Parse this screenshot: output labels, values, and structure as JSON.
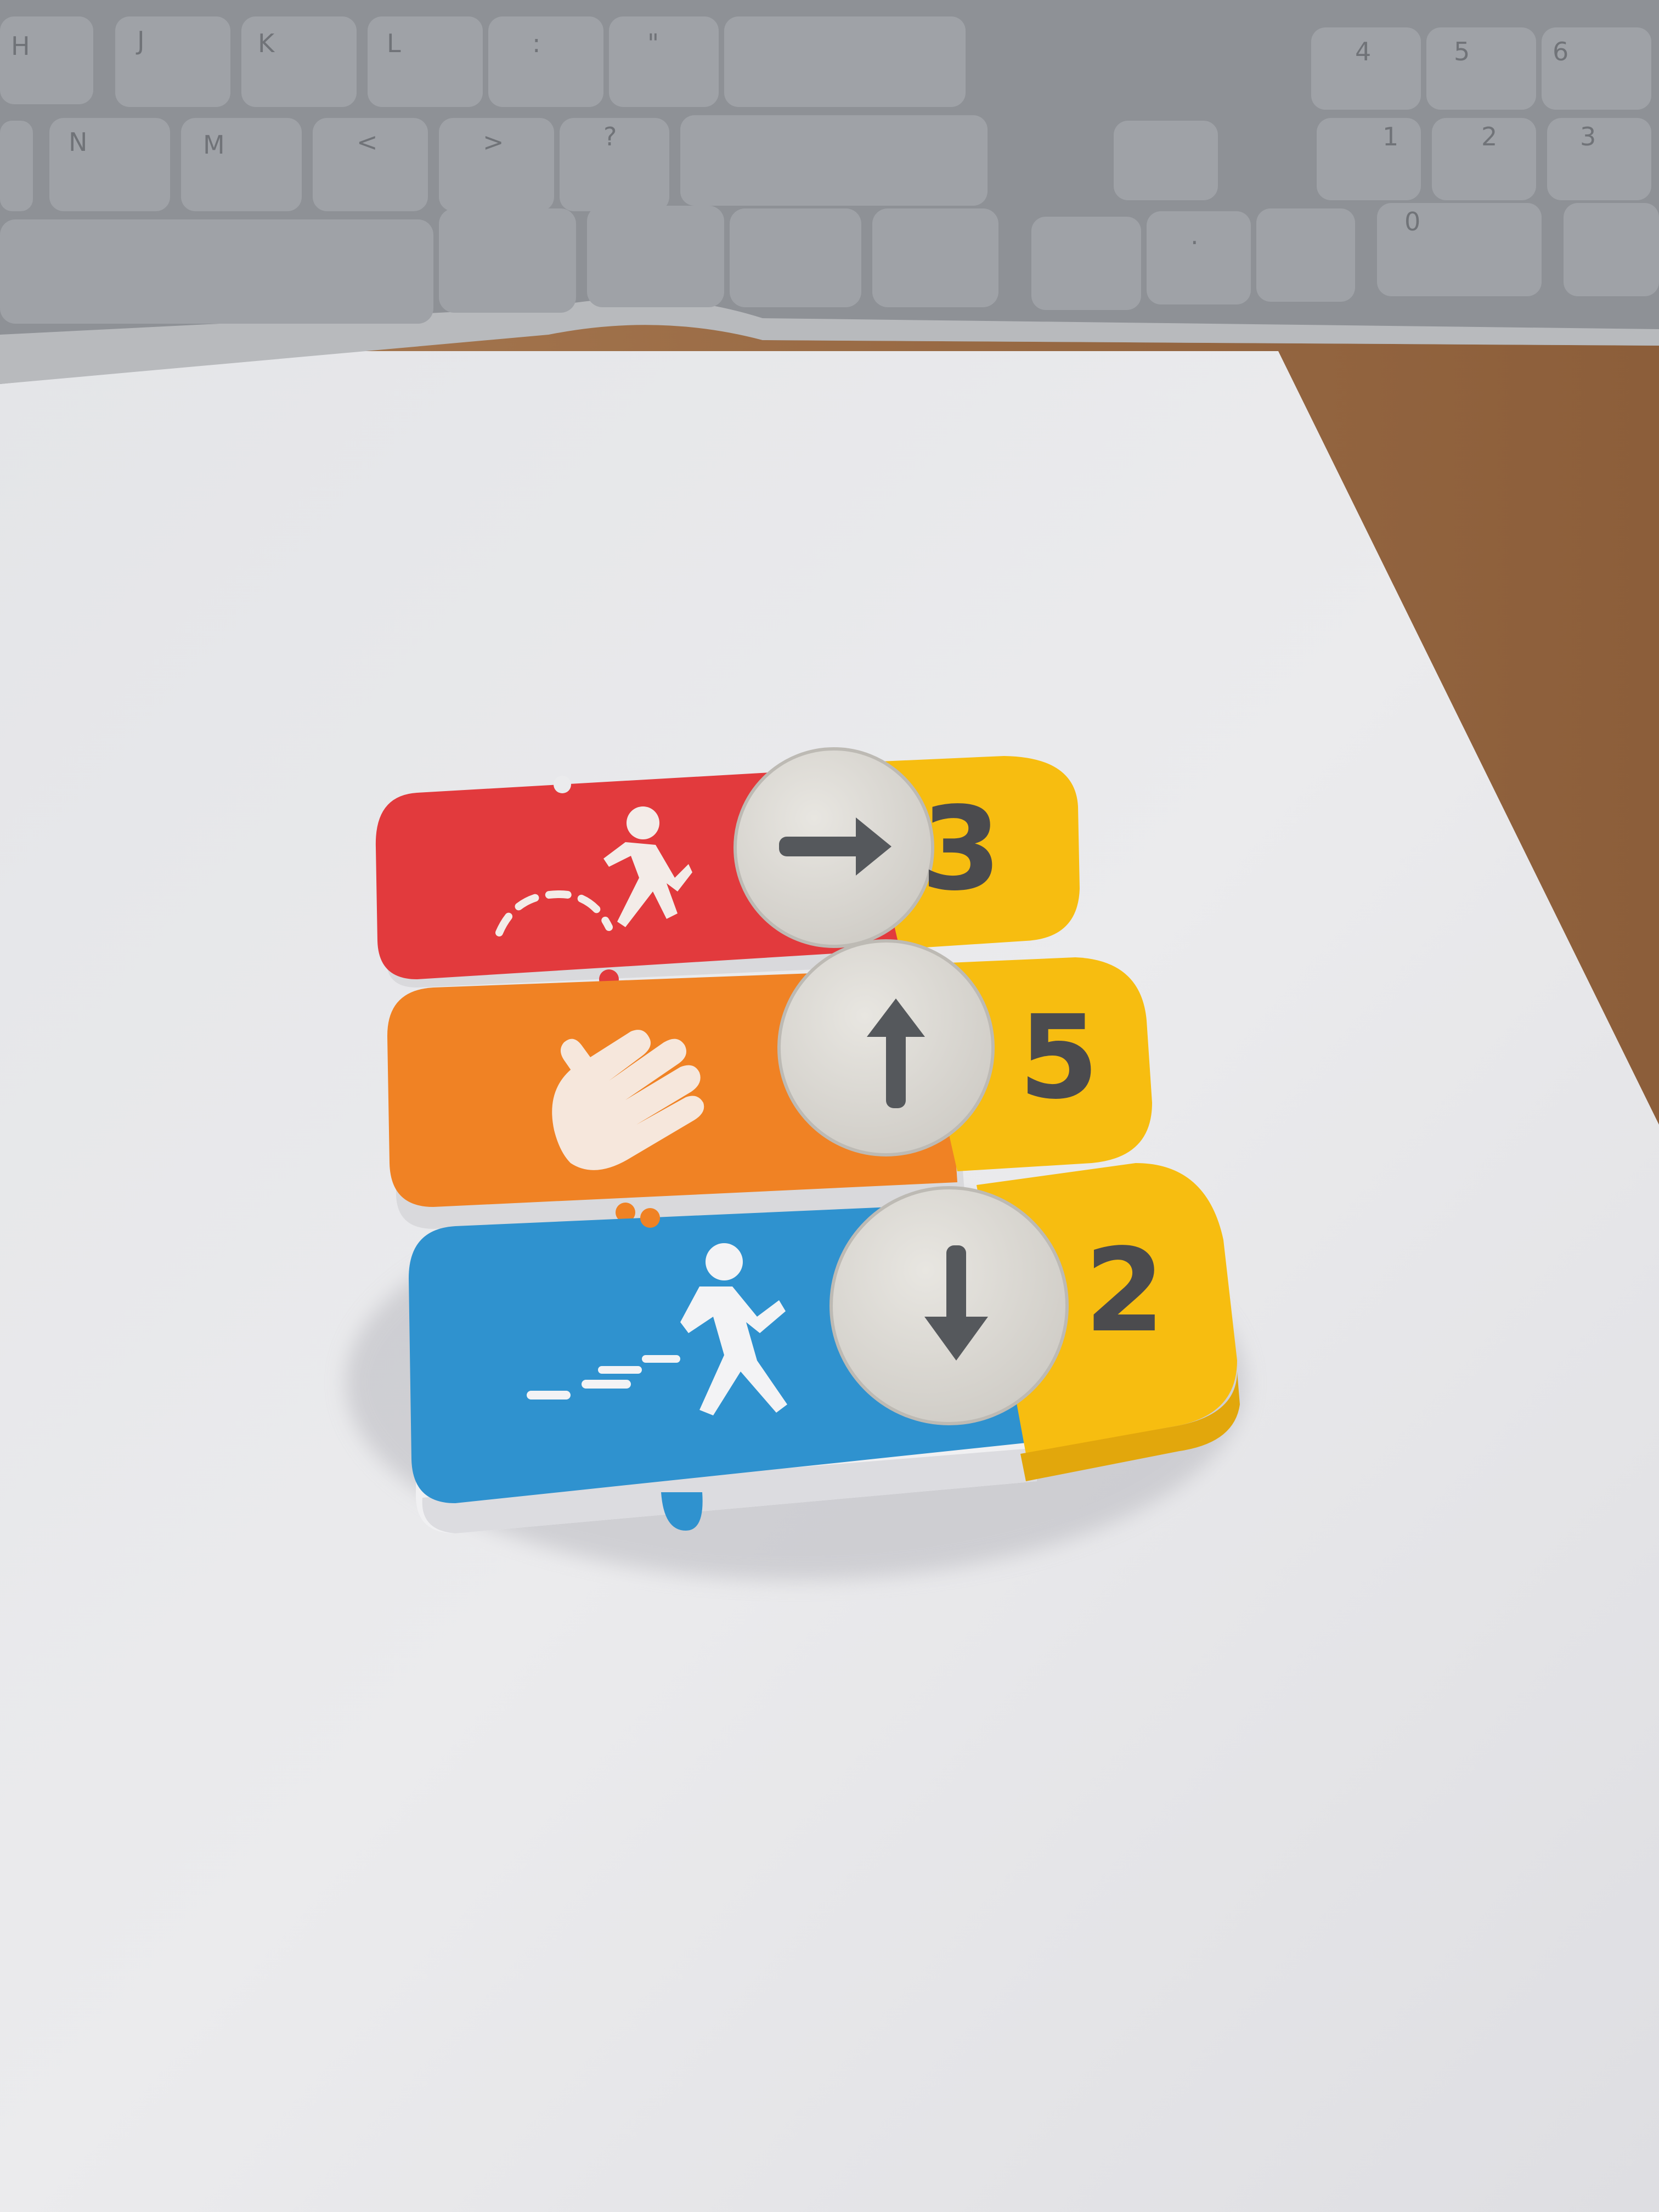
{
  "keyboard": {
    "row1_keys": [
      "H",
      "J",
      "K",
      "L",
      ":",
      "\""
    ],
    "row2_keys": [
      "N",
      "M",
      "<",
      ">",
      "?"
    ],
    "numpad_keys": [
      "4",
      "5",
      "6",
      "1",
      "2",
      "3",
      "0",
      "."
    ]
  },
  "program_tiles": [
    {
      "action_icon": "jump-icon",
      "direction_icon": "arrow-right-icon",
      "count": "3",
      "color": "#e23a3d"
    },
    {
      "action_icon": "hand-wave-icon",
      "direction_icon": "arrow-up-icon",
      "count": "5",
      "color": "#f08224"
    },
    {
      "action_icon": "run-icon",
      "direction_icon": "arrow-down-icon",
      "count": "2",
      "color": "#2f92cf"
    }
  ],
  "colors": {
    "number_block": "#f7bd10",
    "paper": "#e9e9eb",
    "desk": "#9a6a42",
    "keyboard": "#8f9297"
  }
}
